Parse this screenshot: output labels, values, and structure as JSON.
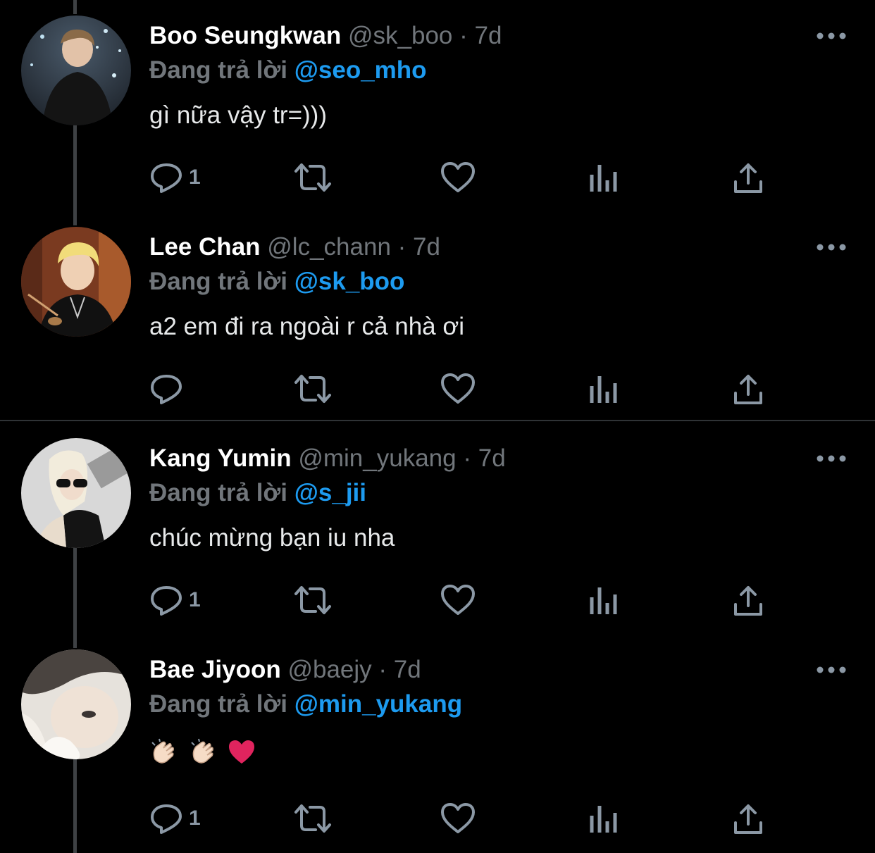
{
  "colors": {
    "background": "#000000",
    "name": "#ffffff",
    "secondary": "#71767b",
    "mention": "#1d9bf0",
    "icon": "#8b98a5",
    "heart": "#e0245e"
  },
  "tweets": [
    {
      "name": "Boo Seungkwan",
      "handle": "@sk_boo",
      "dot": "·",
      "time": "7d",
      "replying_label": "Đang trả lời",
      "mention": "@seo_mho",
      "text": "gì nữa vậy tr=)))",
      "reply_count": "1",
      "icons": [
        "reply-icon",
        "retweet-icon",
        "like-icon",
        "analytics-icon",
        "share-icon",
        "more-icon"
      ]
    },
    {
      "name": "Lee Chan",
      "handle": "@lc_chann",
      "dot": "·",
      "time": "7d",
      "replying_label": "Đang trả lời",
      "mention": "@sk_boo",
      "text": "a2 em đi ra ngoài r cả nhà ơi",
      "reply_count": "",
      "icons": [
        "reply-icon",
        "retweet-icon",
        "like-icon",
        "analytics-icon",
        "share-icon",
        "more-icon"
      ]
    },
    {
      "name": "Kang Yumin",
      "handle": "@min_yukang",
      "dot": "·",
      "time": "7d",
      "replying_label": "Đang trả lời",
      "mention": "@s_jii",
      "text": "chúc mừng bạn iu nha",
      "reply_count": "1",
      "icons": [
        "reply-icon",
        "retweet-icon",
        "like-icon",
        "analytics-icon",
        "share-icon",
        "more-icon"
      ]
    },
    {
      "name": "Bae Jiyoon",
      "handle": "@baejy",
      "dot": "·",
      "time": "7d",
      "replying_label": "Đang trả lời",
      "mention": "@min_yukang",
      "text": "",
      "body_emojis": [
        "clapping-hands-emoji",
        "clapping-hands-emoji",
        "red-heart-emoji"
      ],
      "reply_count": "1",
      "icons": [
        "reply-icon",
        "retweet-icon",
        "like-icon",
        "analytics-icon",
        "share-icon",
        "more-icon"
      ]
    }
  ]
}
